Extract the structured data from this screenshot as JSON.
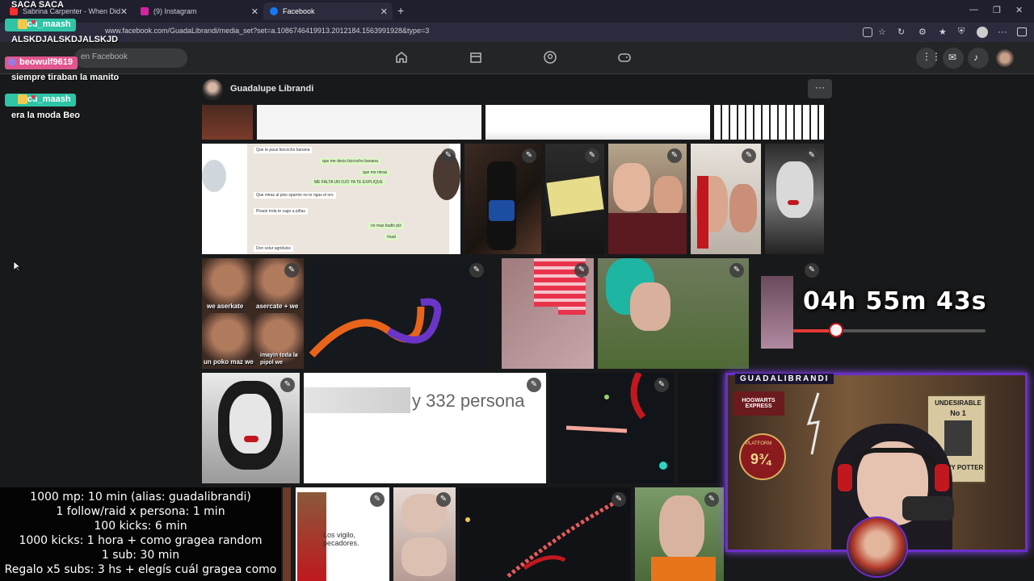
{
  "browser": {
    "tabs": [
      {
        "label": "Sabrina Carpenter - When Did",
        "color": "#ff2d2d"
      },
      {
        "label": "(9) Instagram",
        "color": "#d6249f"
      },
      {
        "label": "Facebook",
        "color": "#1877f2"
      }
    ],
    "url": "www.facebook.com/GuadaLibrandi/media_set?set=a.1086746419913.2012184.1563991928&type=3"
  },
  "facebook": {
    "search_placeholder": "en Facebook",
    "owner_name": "Guadalupe Librandi",
    "more_label": "···"
  },
  "photos": {
    "chat_lines": [
      "Que te paus bizcocho banana",
      "que me decis bizcocho banana",
      "que me miras",
      "ME FALTA UN OJO YA TE EXPLIQUE",
      "Que miras al piso sparmo no te ngas el oro",
      "Piraún trola te cago a piñas",
      "no mas budin plz",
      "#sad",
      "Don solur agridulce"
    ],
    "meme_captions": [
      "we aserkate",
      "asercate + we",
      "un poko maz we",
      "imayin toda la pipol we"
    ],
    "blur_text": "y 332 persona",
    "jesus_text": "Los vigilo, pecadores."
  },
  "chat": [
    {
      "type": "name",
      "name": "facu_maash",
      "color": "#2ec4a5"
    },
    {
      "type": "msg",
      "text": "ALSKDJALSKDJALSKJD"
    },
    {
      "type": "name",
      "name": "beowulf9619",
      "color": "#e0568f"
    },
    {
      "type": "msg",
      "text": "siempre tiraban la manito"
    },
    {
      "type": "name",
      "name": "facu_maash",
      "color": "#2ec4a5"
    },
    {
      "type": "msg",
      "text": "era la moda Beo"
    }
  ],
  "overlay_top_text": "SACA SACA",
  "rules": [
    "1000 mp: 10 min (alias: guadalibrandi)",
    "1 follow/raid x persona: 1 min",
    "100 kicks: 6 min",
    "1000 kicks: 1 hora + como gragea random",
    "1 sub: 30 min",
    "Regalo x5 subs: 3 hs + elegís cuál gragea como"
  ],
  "timer": {
    "text": "04h 55m 43s",
    "progress": 0.22
  },
  "cam": {
    "label": "GUADALIBRANDI",
    "sign_undesirable": "UNDESIRABLE",
    "sign_no1": "No 1",
    "sign_harry": "HARRY POTTER",
    "platform_text": "PLATFORM",
    "platform_num": "9¾",
    "express_text": "HOGWARTS EXPRESS"
  }
}
